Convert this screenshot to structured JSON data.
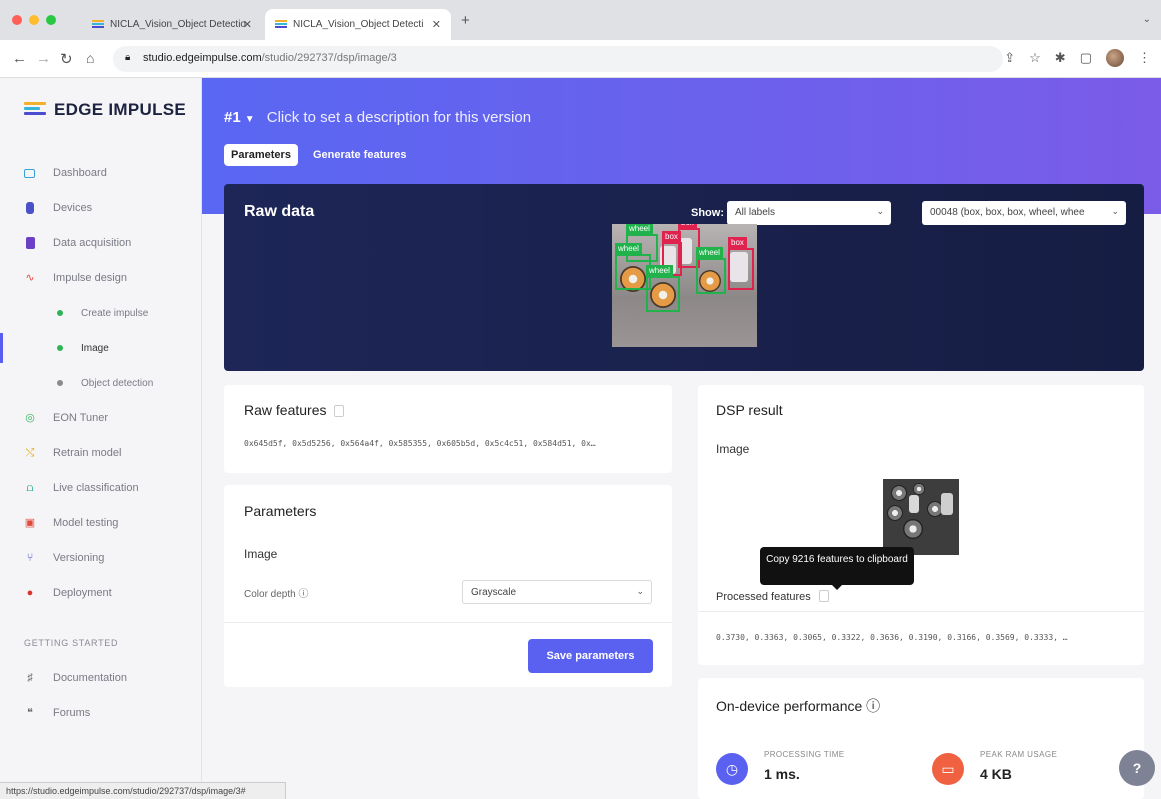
{
  "browser": {
    "tabs": [
      {
        "title": "NICLA_Vision_Object Detectio",
        "active": false
      },
      {
        "title": "NICLA_Vision_Object Detecti",
        "active": true
      }
    ],
    "url_host": "studio.edgeimpulse.com",
    "url_path": "/studio/292737/dsp/image/3",
    "status_url": "https://studio.edgeimpulse.com/studio/292737/dsp/image/3#"
  },
  "sidebar": {
    "logo_text": "EDGE IMPULSE",
    "items": [
      {
        "label": "Dashboard",
        "icon": "monitor-icon",
        "color": "#36a3d9"
      },
      {
        "label": "Devices",
        "icon": "device-icon",
        "color": "#4a51c9"
      },
      {
        "label": "Data acquisition",
        "icon": "database-icon",
        "color": "#6b3fc6"
      },
      {
        "label": "Impulse design",
        "icon": "pulse-icon",
        "color": "#e2493d"
      },
      {
        "label": "Create impulse",
        "icon": "dot-icon",
        "color": "#2fb455"
      },
      {
        "label": "Image",
        "icon": "dot-icon",
        "color": "#2fb455"
      },
      {
        "label": "Object detection",
        "icon": "dot-icon",
        "color": "#8a8a8a"
      },
      {
        "label": "EON Tuner",
        "icon": "tuner-icon",
        "color": "#37b45a"
      },
      {
        "label": "Retrain model",
        "icon": "retrain-icon",
        "color": "#e2b52d"
      },
      {
        "label": "Live classification",
        "icon": "live-icon",
        "color": "#1ea58c"
      },
      {
        "label": "Model testing",
        "icon": "testing-icon",
        "color": "#e2493d"
      },
      {
        "label": "Versioning",
        "icon": "branch-icon",
        "color": "#4a51c9"
      },
      {
        "label": "Deployment",
        "icon": "deploy-icon",
        "color": "#d8352a"
      }
    ],
    "section_title": "GETTING STARTED",
    "getting_started": [
      {
        "label": "Documentation",
        "icon": "docs-icon"
      },
      {
        "label": "Forums",
        "icon": "forums-icon"
      }
    ]
  },
  "header": {
    "version": "#1",
    "description": "Click to set a description for this version",
    "tabs": [
      "Parameters",
      "Generate features"
    ]
  },
  "raw_data": {
    "title": "Raw data",
    "show_label": "Show:",
    "label_filter": "All labels",
    "sample_select": "00048 (box, box, box, wheel, whee",
    "boxes": [
      {
        "label": "wheel",
        "color": "#22b24c"
      },
      {
        "label": "box",
        "color": "#e0224e"
      },
      {
        "label": "box",
        "color": "#e0224e"
      },
      {
        "label": "wheel",
        "color": "#22b24c"
      },
      {
        "label": "wheel",
        "color": "#22b24c"
      },
      {
        "label": "wheel",
        "color": "#22b24c"
      },
      {
        "label": "box",
        "color": "#e0224e"
      }
    ]
  },
  "raw_features": {
    "title": "Raw features",
    "values": "0x645d5f, 0x5d5256, 0x564a4f, 0x585355, 0x605b5d, 0x5c4c51, 0x584d51, 0x…"
  },
  "parameters": {
    "title": "Parameters",
    "section": "Image",
    "color_depth_label": "Color depth ⓘ",
    "color_depth_value": "Grayscale",
    "save_label": "Save parameters"
  },
  "dsp_result": {
    "title": "DSP result",
    "section": "Image",
    "tooltip": "Copy 9216 features to clipboard",
    "processed_label": "Processed features",
    "processed_values": "0.3730, 0.3363, 0.3065, 0.3322, 0.3636, 0.3190, 0.3166, 0.3569, 0.3333, …"
  },
  "performance": {
    "title": "On-device performance ⓘ",
    "processing_time_label": "PROCESSING TIME",
    "processing_time_value": "1 ms.",
    "peak_ram_label": "PEAK RAM USAGE",
    "peak_ram_value": "4 KB"
  },
  "colors": {
    "accent": "#5a61f0",
    "header_start": "#5967f2",
    "header_end": "#7a5ce8",
    "raw_bg": "#1d2657"
  }
}
